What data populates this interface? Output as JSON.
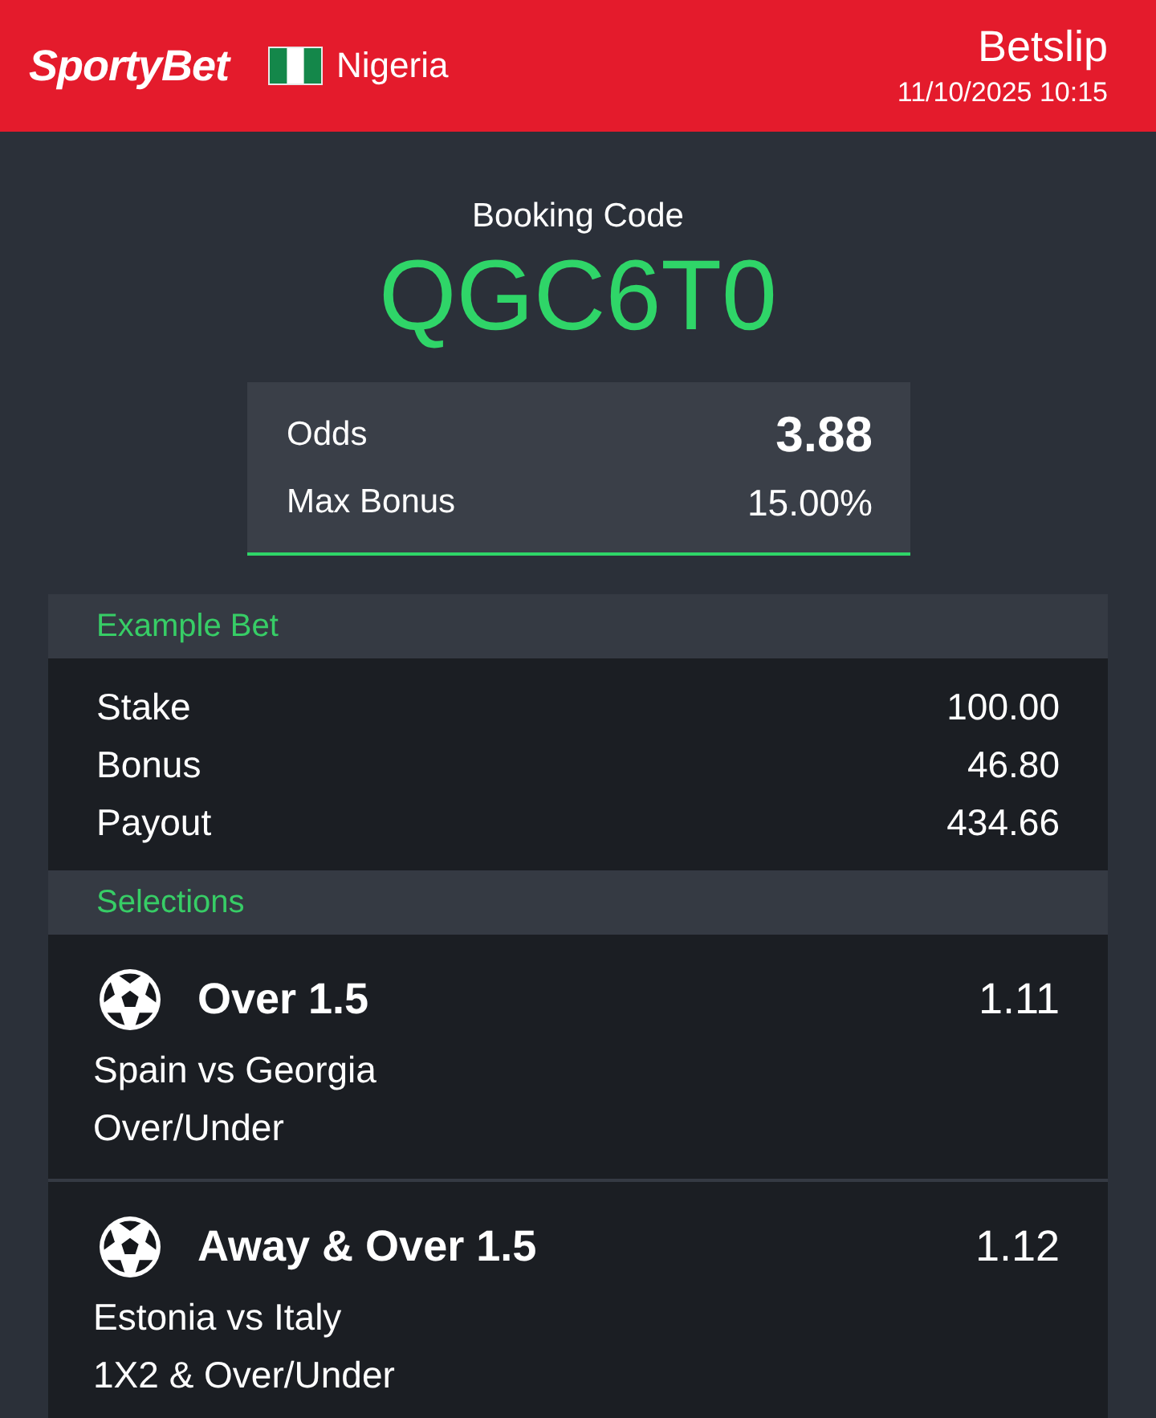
{
  "header": {
    "logo": "SportyBet",
    "country": "Nigeria",
    "title": "Betslip",
    "datetime": "11/10/2025 10:15"
  },
  "booking": {
    "label": "Booking Code",
    "code": "QGC6T0"
  },
  "summary": [
    {
      "kind": "total",
      "label": "Odds",
      "value": "3.88"
    },
    {
      "kind": "plain",
      "label": "Max Bonus",
      "value": "15.00%"
    }
  ],
  "example_bet": {
    "title": "Example Bet",
    "rows": [
      {
        "label": "Stake",
        "value": "100.00"
      },
      {
        "label": "Bonus",
        "value": "46.80"
      },
      {
        "label": "Payout",
        "value": "434.66"
      }
    ]
  },
  "selections": {
    "title": "Selections",
    "items": [
      {
        "pick": "Over 1.5",
        "odds": "1.11",
        "match": "Spain vs Georgia",
        "market": "Over/Under"
      },
      {
        "pick": "Away & Over 1.5",
        "odds": "1.12",
        "match": "Estonia vs Italy",
        "market": "1X2 & Over/Under"
      }
    ]
  }
}
